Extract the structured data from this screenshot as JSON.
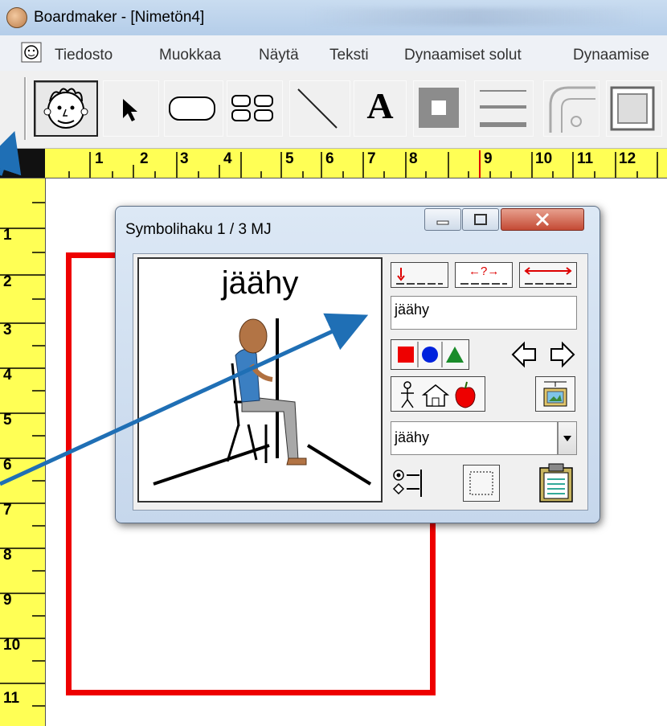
{
  "window": {
    "title": "Boardmaker - [Nimetön4]"
  },
  "menu": {
    "items": [
      "Tiedosto",
      "Muokkaa",
      "Näytä",
      "Teksti",
      "Dynaamiset solut",
      "Dynaamise"
    ]
  },
  "toolbar": {
    "tools": [
      "face-tool-icon",
      "pointer-tool-icon",
      "rounded-rect-tool-icon",
      "grid-tool-icon",
      "line-tool-icon",
      "text-tool-icon",
      "fill-color-tool-icon",
      "line-thickness-tool-icon",
      "corner-tool-icon",
      "frame-tool-icon"
    ],
    "text_tool_label": "A"
  },
  "ruler": {
    "horizontal": [
      "1",
      "2",
      "3",
      "4",
      "5",
      "6",
      "7",
      "8",
      "9",
      "10",
      "11",
      "12"
    ],
    "vertical": [
      "1",
      "2",
      "3",
      "4",
      "5",
      "6",
      "7",
      "8",
      "9",
      "10",
      "11"
    ]
  },
  "dialog": {
    "title": "Symbolihaku  1 / 3   MJ",
    "preview_word": "jäähy",
    "search_value": "jäähy",
    "category_value": "jäähy",
    "top_buttons": {
      "b1": "↓",
      "b2": "←?→",
      "b3": "⟷"
    }
  },
  "colors": {
    "ruler": "#ffff55",
    "frame": "#ee0000",
    "annotation_arrow": "#1f6fb5"
  }
}
